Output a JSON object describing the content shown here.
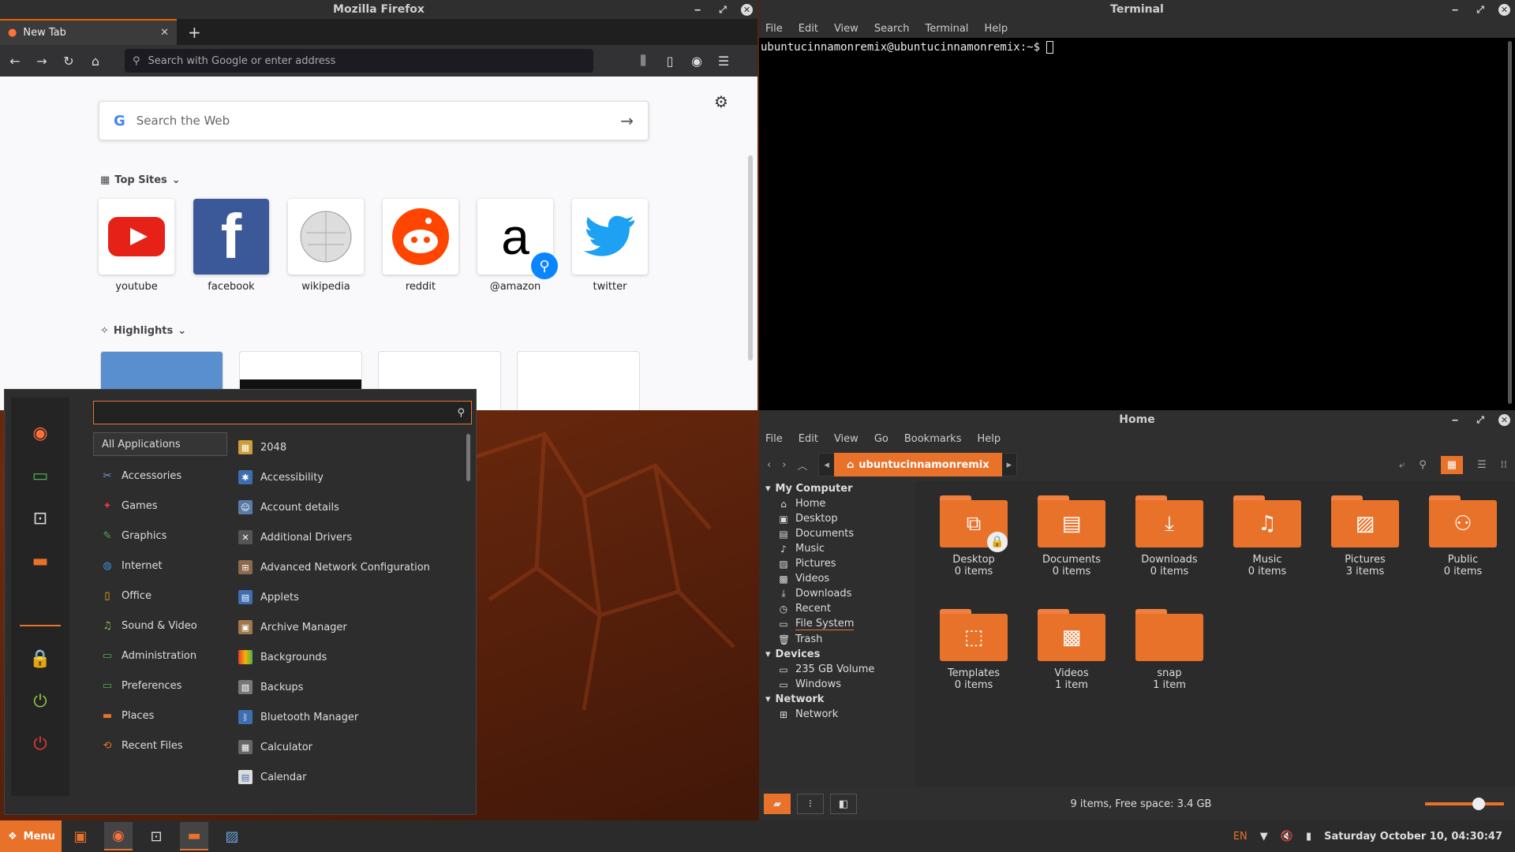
{
  "firefox": {
    "title": "Mozilla Firefox",
    "tab_label": "New Tab",
    "url_placeholder": "Search with Google or enter address",
    "search_placeholder": "Search the Web",
    "top_sites_label": "Top Sites",
    "highlights_label": "Highlights",
    "top_sites": [
      {
        "label": "youtube"
      },
      {
        "label": "facebook"
      },
      {
        "label": "wikipedia"
      },
      {
        "label": "reddit"
      },
      {
        "label": "@amazon"
      },
      {
        "label": "twitter"
      }
    ]
  },
  "terminal": {
    "title": "Terminal",
    "menu": [
      "File",
      "Edit",
      "View",
      "Search",
      "Terminal",
      "Help"
    ],
    "prompt": "ubuntucinnamonremix@ubuntucinnamonremix:~$ "
  },
  "files": {
    "title": "Home",
    "menu": [
      "File",
      "Edit",
      "View",
      "Go",
      "Bookmarks",
      "Help"
    ],
    "breadcrumb": "ubuntucinnamonremix",
    "sidebar": {
      "my_computer": "My Computer",
      "places": [
        "Home",
        "Desktop",
        "Documents",
        "Music",
        "Pictures",
        "Videos",
        "Downloads",
        "Recent",
        "File System",
        "Trash"
      ],
      "devices_label": "Devices",
      "devices": [
        "235 GB Volume",
        "Windows"
      ],
      "network_label": "Network",
      "network": [
        "Network"
      ]
    },
    "items": [
      {
        "name": "Desktop",
        "count": "0 items"
      },
      {
        "name": "Documents",
        "count": "0 items"
      },
      {
        "name": "Downloads",
        "count": "0 items"
      },
      {
        "name": "Music",
        "count": "0 items"
      },
      {
        "name": "Pictures",
        "count": "3 items"
      },
      {
        "name": "Public",
        "count": "0 items"
      },
      {
        "name": "Templates",
        "count": "0 items"
      },
      {
        "name": "Videos",
        "count": "1 item"
      },
      {
        "name": "snap",
        "count": "1 item"
      }
    ],
    "status": "9 items, Free space: 3.4 GB"
  },
  "menu": {
    "categories": [
      "All Applications",
      "Accessories",
      "Games",
      "Graphics",
      "Internet",
      "Office",
      "Sound & Video",
      "Administration",
      "Preferences",
      "Places",
      "Recent Files"
    ],
    "apps": [
      "2048",
      "Accessibility",
      "Account details",
      "Additional Drivers",
      "Advanced Network Configuration",
      "Applets",
      "Archive Manager",
      "Backgrounds",
      "Backups",
      "Bluetooth Manager",
      "Calculator",
      "Calendar"
    ]
  },
  "panel": {
    "menu_label": "Menu",
    "lang": "EN",
    "clock": "Saturday October 10, 04:30:47"
  },
  "colors": {
    "accent": "#e9722b"
  }
}
